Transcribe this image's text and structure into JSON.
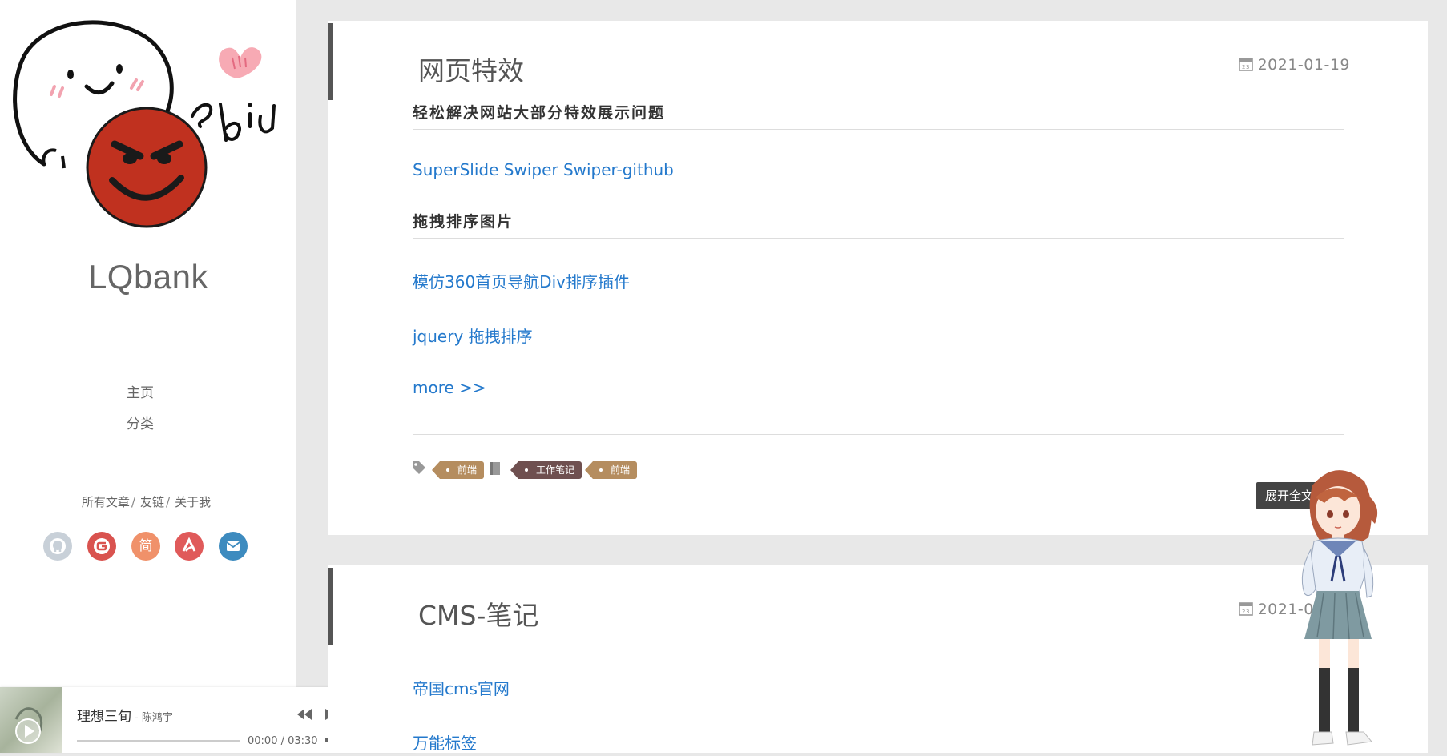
{
  "site": {
    "title": "LQbank"
  },
  "nav": {
    "items": [
      {
        "label": "主页"
      },
      {
        "label": "分类"
      }
    ]
  },
  "quick_links": [
    {
      "label": "所有文章"
    },
    {
      "label": "友链"
    },
    {
      "label": "关于我"
    }
  ],
  "social": [
    {
      "icon": "github-icon",
      "color": "#c8d0d8"
    },
    {
      "icon": "gitee-icon",
      "color": "#d9534f"
    },
    {
      "icon": "jianshu-icon",
      "label": "简",
      "color": "#f0916a"
    },
    {
      "icon": "csdn-icon",
      "color": "#e05a5a"
    },
    {
      "icon": "email-icon",
      "color": "#3d8bbf"
    }
  ],
  "player": {
    "title": "理想三旬",
    "artist": "- 陈鸿宇",
    "time": "00:00 / 03:30",
    "progress": 0
  },
  "posts": [
    {
      "title": "网页特效",
      "date": "2021-01-19",
      "section1": "轻松解决网站大部分特效展示问题",
      "links1": [
        "SuperSlide Swiper Swiper-github"
      ],
      "section2": "拖拽排序图片",
      "links2": [
        "模仿360首页导航Div排序插件",
        "jquery 拖拽排序"
      ],
      "more": "more >>",
      "tags": [
        "前端",
        "工作笔记",
        "前端"
      ],
      "expand": "展开全文 >>"
    },
    {
      "title": "CMS-笔记",
      "date": "2021-01-19",
      "links": [
        "帝国cms官网",
        "万能标签"
      ]
    }
  ],
  "colors": {
    "link": "#2479cc",
    "accent_bar": "#555555",
    "tag_a": "#b58d5f",
    "tag_b": "#6f5050"
  }
}
